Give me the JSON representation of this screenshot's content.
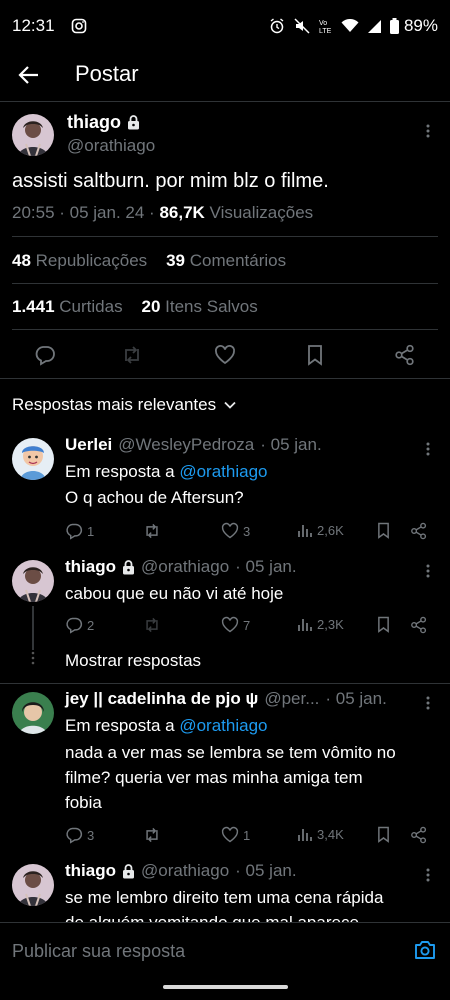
{
  "status_bar": {
    "time": "12:31",
    "battery": "89%",
    "icons": [
      "instagram-icon",
      "alarm-icon",
      "mute-icon",
      "volte-icon",
      "wifi-icon",
      "signal-icon",
      "battery-icon"
    ]
  },
  "header": {
    "title": "Postar",
    "back_icon": "arrow-left-icon"
  },
  "main_tweet": {
    "name": "thiago",
    "handle": "@orathiago",
    "text": "assisti saltburn. por mim blz o filme.",
    "time": "20:55 · 05 jan. 24 · ",
    "views_count": "86,7K",
    "views_label": " Visualizações",
    "reposts_count": "48",
    "reposts_label": "Republicações",
    "comments_count": "39",
    "comments_label": "Comentários",
    "likes_count": "1.441",
    "likes_label": "Curtidas",
    "saves_count": "20",
    "saves_label": "Itens Salvos"
  },
  "replies_filter": {
    "label": "Respostas mais relevantes"
  },
  "replies": [
    {
      "name": "Uerlei",
      "handle": "@WesleyPedroza",
      "date": "· 05 jan.",
      "reply_to_prefix": "Em resposta a",
      "reply_to_handle": "@orathiago",
      "text": "O q achou de Aftersun?",
      "replies": "1",
      "retweets": "",
      "likes": "3",
      "views": "2,6K"
    },
    {
      "name": "thiago",
      "handle": "@orathiago",
      "date": "· 05 jan.",
      "text": "cabou que eu não vi até hoje",
      "replies": "2",
      "retweets": "",
      "likes": "7",
      "views": "2,3K",
      "show_replies": "Mostrar respostas"
    },
    {
      "name": "jey || cadelinha de pjo ψ",
      "handle": "@per...",
      "date": "· 05 jan.",
      "reply_to_prefix": "Em resposta a",
      "reply_to_handle": "@orathiago",
      "text_lines": [
        "nada a ver mas se lembra se tem vômito no",
        "filme? queria ver mas minha amiga tem",
        "fobia"
      ],
      "replies": "3",
      "retweets": "",
      "likes": "1",
      "views": "3,4K"
    },
    {
      "name": "thiago",
      "handle": "@orathiago",
      "date": "· 05 jan.",
      "text_lines": [
        "se me lembro direito tem uma cena rápida",
        "de alguém vomitando que mal aparece"
      ]
    }
  ],
  "compose": {
    "placeholder": "Publicar sua resposta"
  },
  "colors": {
    "background": "#000000",
    "text": "#e7e9ea",
    "muted": "#71767b",
    "link": "#1d9bf0",
    "divider": "#2f3336"
  }
}
